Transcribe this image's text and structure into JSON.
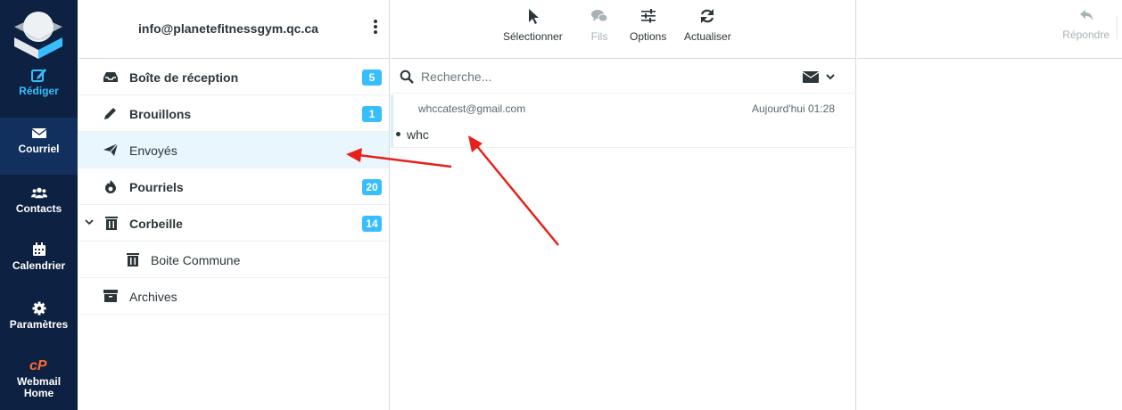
{
  "nav": {
    "compose": "Rédiger",
    "mail": "Courriel",
    "contacts": "Contacts",
    "calendar": "Calendrier",
    "settings": "Paramètres",
    "webmail_home_line1": "Webmail",
    "webmail_home_line2": "Home"
  },
  "account": {
    "email": "info@planetefitnessgym.qc.ca"
  },
  "folders": [
    {
      "label": "Boîte de réception",
      "count": "5",
      "icon": "inbox-icon"
    },
    {
      "label": "Brouillons",
      "count": "1",
      "icon": "pencil-icon"
    },
    {
      "label": "Envoyés",
      "count": "",
      "icon": "paper-plane-icon"
    },
    {
      "label": "Pourriels",
      "count": "20",
      "icon": "fire-icon"
    },
    {
      "label": "Corbeille",
      "count": "14",
      "icon": "trash-icon"
    },
    {
      "label": "Boite Commune",
      "count": "",
      "icon": "trash-icon"
    },
    {
      "label": "Archives",
      "count": "",
      "icon": "archive-icon"
    }
  ],
  "toolbar": {
    "select": "Sélectionner",
    "threads": "Fils",
    "options": "Options",
    "refresh": "Actualiser"
  },
  "search": {
    "placeholder": "Recherche..."
  },
  "messages": [
    {
      "from": "whccatest@gmail.com",
      "date": "Aujourd'hui 01:28",
      "subject": "whc"
    }
  ],
  "preview": {
    "reply": "Répondre"
  },
  "colors": {
    "nav_bg": "#0d2142",
    "accent": "#37beff",
    "selected_bg": "#e9f6fd",
    "annotation": "#e8201b"
  }
}
